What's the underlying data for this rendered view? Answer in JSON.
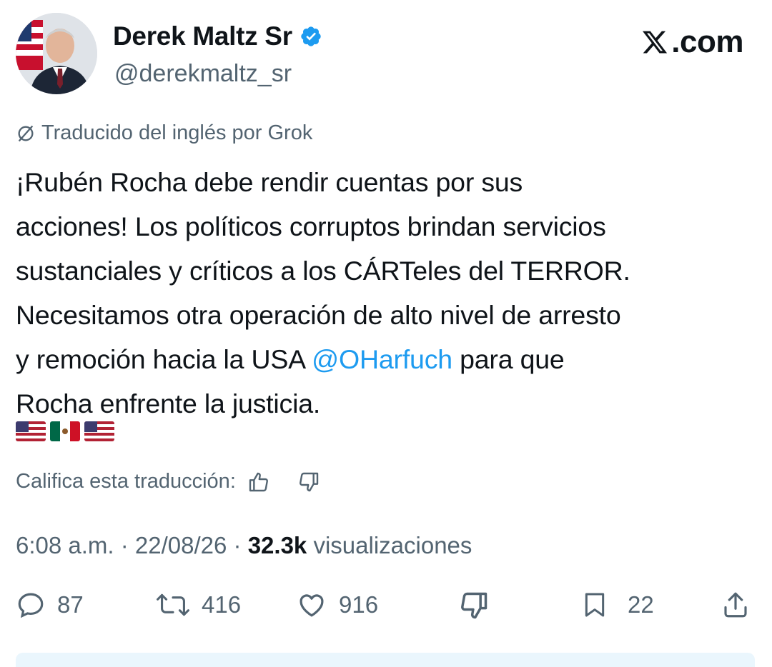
{
  "author": {
    "name": "Derek Maltz Sr",
    "handle": "@derekmaltz_sr",
    "verified": true
  },
  "brand": {
    "site_label": ".com"
  },
  "translation": {
    "notice": "Traducido del inglés por Grok",
    "rate_prompt": "Califica esta traducción:"
  },
  "tweet": {
    "lines": [
      "¡Rubén Rocha debe rendir cuentas por sus",
      "acciones! Los políticos corruptos brindan servicios",
      "sustanciales y críticos a los CÁRTeles del TERROR.",
      "Necesitamos otra operación de alto nivel de arresto"
    ],
    "line5_before": "y remoción hacia la USA ",
    "mention": "@OHarfuch",
    "line5_after": " para que",
    "line6": "Rocha enfrente la justicia.",
    "emojis": [
      "us-flag",
      "mx-flag",
      "us-flag"
    ]
  },
  "meta": {
    "time": "6:08 a.m.",
    "sep1": " · ",
    "date": "22/08/26",
    "sep2": " · ",
    "views_count": "32.3k",
    "views_label": " visualizaciones"
  },
  "actions": {
    "replies": "87",
    "reposts": "416",
    "likes": "916",
    "bookmarks": "22"
  },
  "colors": {
    "text": "#0f1419",
    "secondary": "#536471",
    "link": "#1d9bf0",
    "verified": "#1d9bf0"
  }
}
